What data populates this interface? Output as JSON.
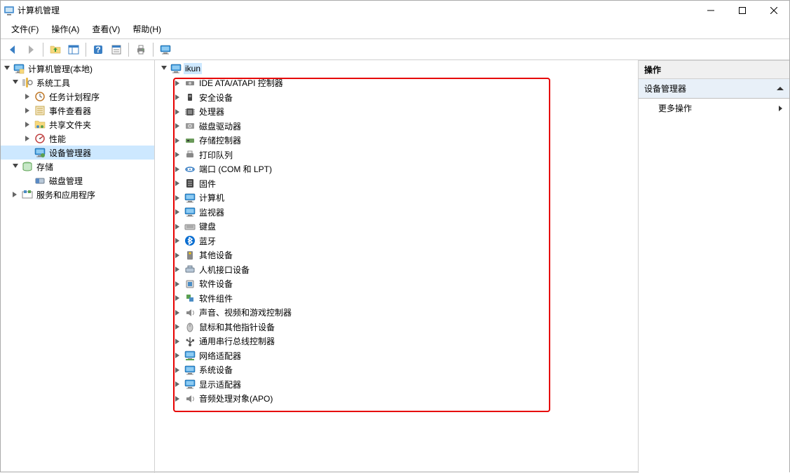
{
  "title": "计算机管理",
  "menu": {
    "file": "文件(F)",
    "action": "操作(A)",
    "view": "查看(V)",
    "help": "帮助(H)"
  },
  "left_tree": {
    "root": "计算机管理(本地)",
    "system_tools": "系统工具",
    "task_scheduler": "任务计划程序",
    "event_viewer": "事件查看器",
    "shared_folders": "共享文件夹",
    "performance": "性能",
    "device_manager": "设备管理器",
    "storage": "存储",
    "disk_mgmt": "磁盘管理",
    "services_apps": "服务和应用程序"
  },
  "device_tree": {
    "computer_name": "ikun",
    "items": [
      {
        "id": "ide",
        "label": "IDE ATA/ATAPI 控制器"
      },
      {
        "id": "security",
        "label": "安全设备"
      },
      {
        "id": "processor",
        "label": "处理器"
      },
      {
        "id": "disk-drive",
        "label": "磁盘驱动器"
      },
      {
        "id": "storage-ctrl",
        "label": "存储控制器"
      },
      {
        "id": "print-queue",
        "label": "打印队列"
      },
      {
        "id": "ports",
        "label": "端口 (COM 和 LPT)"
      },
      {
        "id": "firmware",
        "label": "固件"
      },
      {
        "id": "computer",
        "label": "计算机"
      },
      {
        "id": "monitor",
        "label": "监视器"
      },
      {
        "id": "keyboard",
        "label": "键盘"
      },
      {
        "id": "bluetooth",
        "label": "蓝牙"
      },
      {
        "id": "other",
        "label": "其他设备"
      },
      {
        "id": "hid",
        "label": "人机接口设备"
      },
      {
        "id": "software-devices",
        "label": "软件设备"
      },
      {
        "id": "software-components",
        "label": "软件组件"
      },
      {
        "id": "sound",
        "label": "声音、视频和游戏控制器"
      },
      {
        "id": "mouse",
        "label": "鼠标和其他指针设备"
      },
      {
        "id": "usb",
        "label": "通用串行总线控制器"
      },
      {
        "id": "network",
        "label": "网络适配器"
      },
      {
        "id": "system-devices",
        "label": "系统设备"
      },
      {
        "id": "display",
        "label": "显示适配器"
      },
      {
        "id": "apo",
        "label": "音频处理对象(APO)"
      }
    ]
  },
  "right_pane": {
    "header": "操作",
    "section": "设备管理器",
    "more": "更多操作"
  }
}
